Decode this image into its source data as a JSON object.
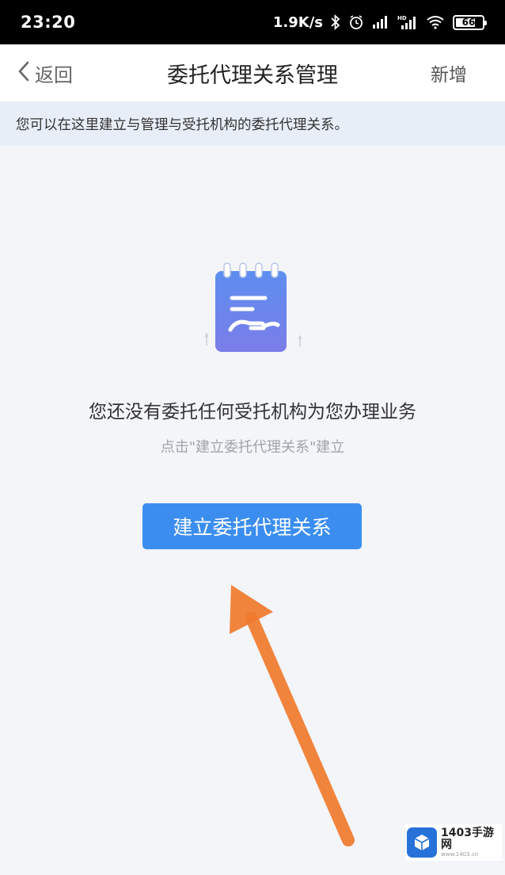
{
  "status_bar": {
    "time": "23:20",
    "network_speed": "1.9K/s",
    "icons": [
      "bluetooth-icon",
      "alarm-icon",
      "signal-icon",
      "hd-signal-icon",
      "wifi-icon"
    ],
    "battery": "66"
  },
  "nav": {
    "back_label": "返回",
    "title": "委托代理关系管理",
    "action_label": "新增"
  },
  "banner": {
    "text": "您可以在这里建立与管理与受托机构的委托代理关系。"
  },
  "empty_state": {
    "illustration": "notepad-hand-icon",
    "title": "您还没有委托任何受托机构为您办理业务",
    "hint": "点击\"建立委托代理关系\"建立"
  },
  "primary_button": {
    "label": "建立委托代理关系"
  },
  "watermark": {
    "name": "1403手游网",
    "url": "www.1403.cn"
  },
  "colors": {
    "accent": "#3b8ef0",
    "banner_bg": "#e8eef8",
    "page_bg": "#f3f5f8",
    "annotation_arrow": "#f07a2c"
  }
}
